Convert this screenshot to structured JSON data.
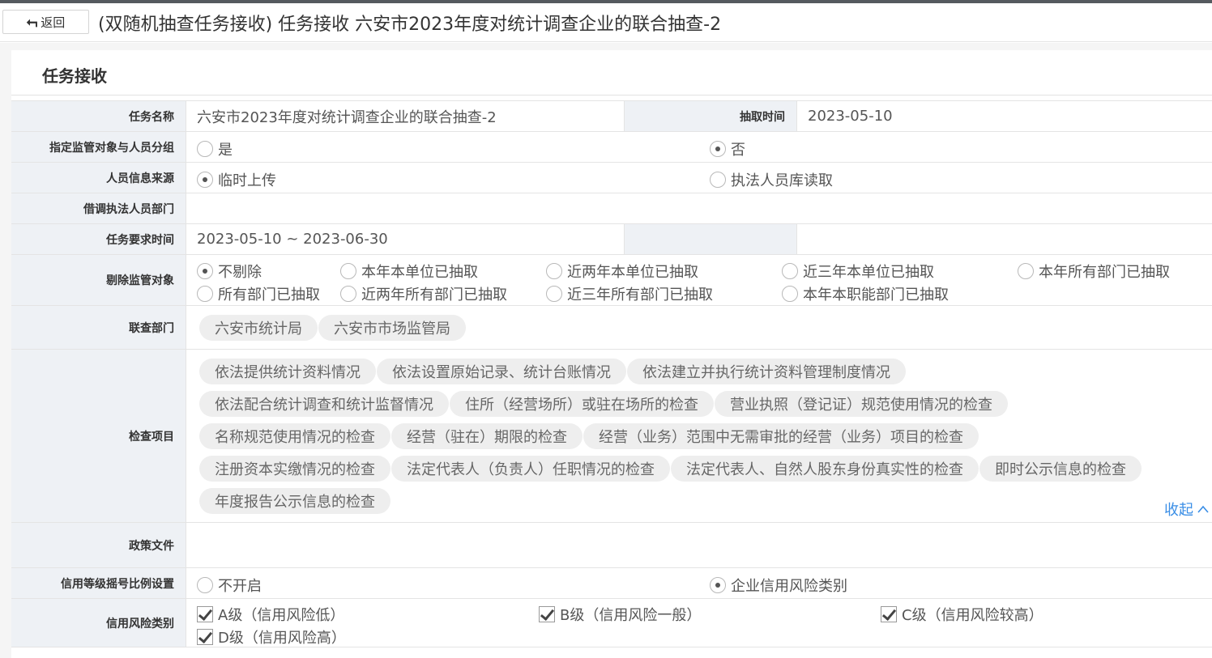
{
  "header": {
    "back_label": "返回",
    "title": "(双随机抽查任务接收) 任务接收 六安市2023年度对统计调查企业的联合抽查-2"
  },
  "section": {
    "title": "任务接收"
  },
  "form": {
    "task_name": {
      "label": "任务名称",
      "value": "六安市2023年度对统计调查企业的联合抽查-2"
    },
    "extract_time": {
      "label": "抽取时间",
      "value": "2023-05-10"
    },
    "designate": {
      "label": "指定监管对象与人员分组",
      "options": [
        "是",
        "否"
      ],
      "selected": "否"
    },
    "personnel_source": {
      "label": "人员信息来源",
      "options": [
        "临时上传",
        "执法人员库读取"
      ],
      "selected": "临时上传"
    },
    "borrowed_dept": {
      "label": "借调执法人员部门",
      "value": ""
    },
    "required_time": {
      "label": "任务要求时间",
      "value": "2023-05-10 ~ 2023-06-30"
    },
    "exclude": {
      "label": "剔除监管对象",
      "options": [
        "不剔除",
        "本年本单位已抽取",
        "近两年本单位已抽取",
        "近三年本单位已抽取",
        "本年所有部门已抽取",
        "所有部门已抽取",
        "近两年所有部门已抽取",
        "近三年所有部门已抽取",
        "本年本职能部门已抽取"
      ],
      "selected": "不剔除"
    },
    "joint_dept": {
      "label": "联查部门",
      "tags": [
        "六安市统计局",
        "六安市市场监管局"
      ]
    },
    "inspection_items": {
      "label": "检查项目",
      "tags": [
        "依法提供统计资料情况",
        "依法设置原始记录、统计台账情况",
        "依法建立并执行统计资料管理制度情况",
        "依法配合统计调查和统计监督情况",
        "住所（经营场所）或驻在场所的检查",
        "营业执照（登记证）规范使用情况的检查",
        "名称规范使用情况的检查",
        "经营（驻在）期限的检查",
        "经营（业务）范围中无需审批的经营（业务）项目的检查",
        "注册资本实缴情况的检查",
        "法定代表人（负责人）任职情况的检查",
        "法定代表人、自然人股东身份真实性的检查",
        "即时公示信息的检查",
        "年度报告公示信息的检查"
      ],
      "collapse_label": "收起",
      "collapse_icon": "chevron-up-icon"
    },
    "policy_files": {
      "label": "政策文件",
      "value": ""
    },
    "credit_ratio": {
      "label": "信用等级摇号比例设置",
      "options": [
        "不开启",
        "企业信用风险类别"
      ],
      "selected": "企业信用风险类别"
    },
    "credit_risk": {
      "label": "信用风险类别",
      "options": [
        "A级（信用风险低）",
        "B级（信用风险一般）",
        "C级（信用风险较高）",
        "D级（信用风险高）"
      ],
      "checked": [
        true,
        true,
        true,
        true
      ]
    }
  }
}
